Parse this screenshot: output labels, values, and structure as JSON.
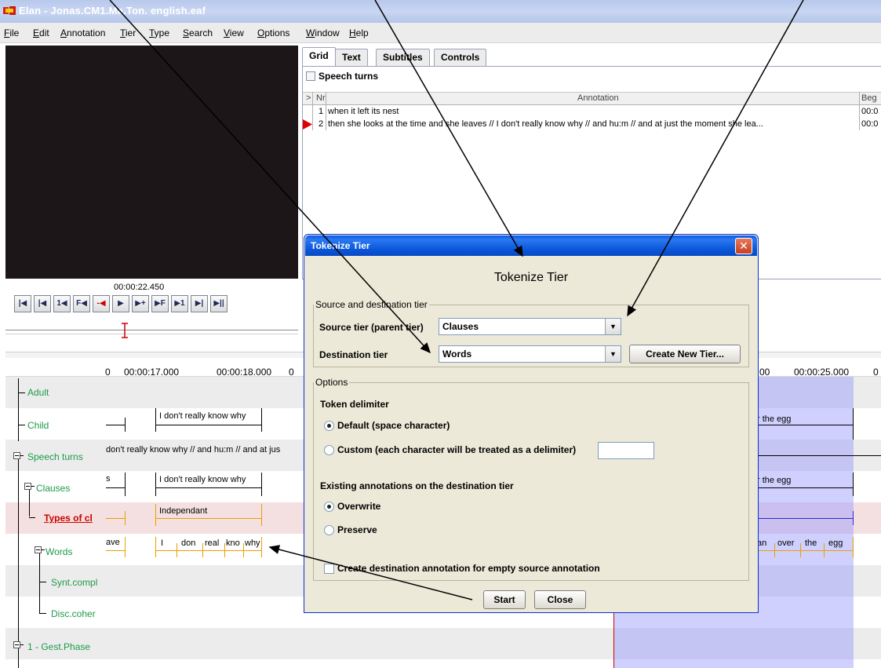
{
  "window": {
    "title": "Elan - Jonas.CM1.Ma.Ton. english.eaf"
  },
  "menu": [
    "File",
    "Edit",
    "Annotation",
    "Tier",
    "Type",
    "Search",
    "View",
    "Options",
    "Window",
    "Help"
  ],
  "grid": {
    "tabs": [
      "Grid",
      "Text",
      "Subtitles",
      "Controls"
    ],
    "active_tab": "Grid",
    "tier_name": "Speech turns",
    "columns": {
      "marker": ">",
      "nr": "Nr",
      "annotation": "Annotation",
      "begin": "Beg"
    },
    "rows": [
      {
        "nr": "1",
        "annotation": "when it left its nest",
        "begin": "00:0",
        "current": false
      },
      {
        "nr": "2",
        "annotation": "then she looks at the time and she leaves // I don't really know why // and hu:m // and at just the moment she lea...",
        "begin": "00:0",
        "current": true
      }
    ]
  },
  "media": {
    "time": "00:00:22.450"
  },
  "timeline": {
    "ruler": [
      "0",
      "00:00:17.000",
      "00:00:18.000",
      "0",
      "00",
      "00:00:25.000",
      "0"
    ],
    "tiers": [
      {
        "name": "Adult"
      },
      {
        "name": "Child"
      },
      {
        "name": "Speech turns"
      },
      {
        "name": "Clauses"
      },
      {
        "name": "Types of cl"
      },
      {
        "name": "Words"
      },
      {
        "name": "Synt.compl"
      },
      {
        "name": "Disc.coher"
      },
      {
        "name": "1 - Gest.Phase"
      }
    ],
    "annotations": {
      "child_1": "I don't really know why",
      "child_2": "r the egg",
      "speech": "don't really know why // and hu:m // and at jus",
      "clauses_pre": "s",
      "clauses_1": "I don't really know why",
      "clauses_2": "r the egg",
      "types_1": "Independant",
      "words_pre": "ave",
      "words": [
        "I",
        "don",
        "real",
        "kno",
        "why"
      ],
      "words_right": [
        "an",
        "over",
        "the",
        "egg"
      ]
    }
  },
  "dialog": {
    "title": "Tokenize Tier",
    "heading": "Tokenize Tier",
    "source_group": "Source and destination tier",
    "source_label": "Source tier (parent tier)",
    "source_value": "Clauses",
    "dest_label": "Destination tier",
    "dest_value": "Words",
    "create_button": "Create New Tier...",
    "options_group": "Options",
    "delimiter_label": "Token delimiter",
    "radio_default": "Default (space character)",
    "radio_custom": "Custom (each character will be treated as a delimiter)",
    "custom_value": "",
    "existing_label": "Existing annotations on the destination tier",
    "radio_overwrite": "Overwrite",
    "radio_preserve": "Preserve",
    "empty_check": "Create destination annotation for empty source annotation",
    "start_button": "Start",
    "close_button": "Close",
    "close_icon": "close-icon"
  },
  "colors": {
    "tier_label": "#1e9a4a",
    "selected_tier": "#cc0000",
    "selection": "#9696ff",
    "dialog_title": "#0a5be0"
  }
}
